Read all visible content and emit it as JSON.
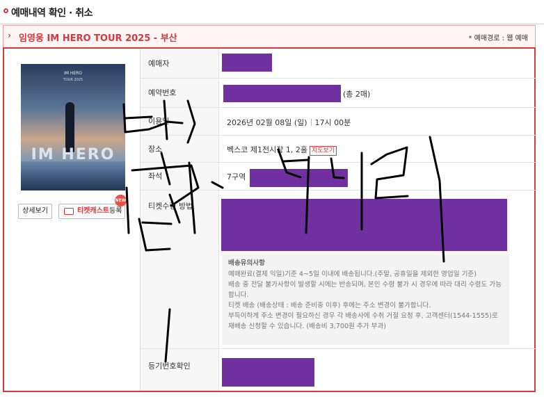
{
  "page": {
    "title": "예매내역 확인 · 취소"
  },
  "event": {
    "chevron": "›",
    "title": "임영웅 IM HERO TOUR 2025 - 부산",
    "booking_route": "* 예매경로 : 웹 예매"
  },
  "poster": {
    "title": "IM HERO",
    "subtitle": "TOUR 2025",
    "logo": "IM HERO"
  },
  "buttons": {
    "detail": "상세보기",
    "ticketcast_red": "티켓캐스트",
    "ticketcast_rest": "등록",
    "new_badge": "NEW"
  },
  "rows": {
    "booker_label": "예매자",
    "booking_no_label": "예약번호",
    "booking_count": "(총 2매)",
    "date_label": "이용일",
    "date_value": "2026년 02월 08일 (일)",
    "time_value": "17시 00분",
    "venue_label": "장소",
    "venue_value": "벡스코 제1전시장 1, 2홀",
    "map_link": "지도보기",
    "seat_label": "좌석",
    "seat_value": "7구역",
    "receive_label": "티켓수령 방법",
    "tracking_label": "등기번호확인"
  },
  "notice": {
    "title": "배송유의사항",
    "lines": [
      "예매완료(결제 익일)기준 4~5일 이내에 배송됩니다.(주말, 공휴일을 제외한 영업일 기준)",
      "배송 중 전달 불가사항이 발생할 시에는 반송되며, 본인 수령 불가 시 경우에 따라 대리 수령도 가능합니다.",
      "티켓 배송 (배송상태 : 배송 준비중 이후) 후에는 주소 변경이 불가합니다.",
      "부득이하게 주소 변경이 필요하신 경우 각 배송사에 수취 거절 요청 후, 고객센터(1544-1555)로 재배송 신청할 수 있습니다. (배송비 3,700원 추가 부과)"
    ]
  },
  "colors": {
    "accent": "#d8373b",
    "redaction": "#7030a0"
  }
}
